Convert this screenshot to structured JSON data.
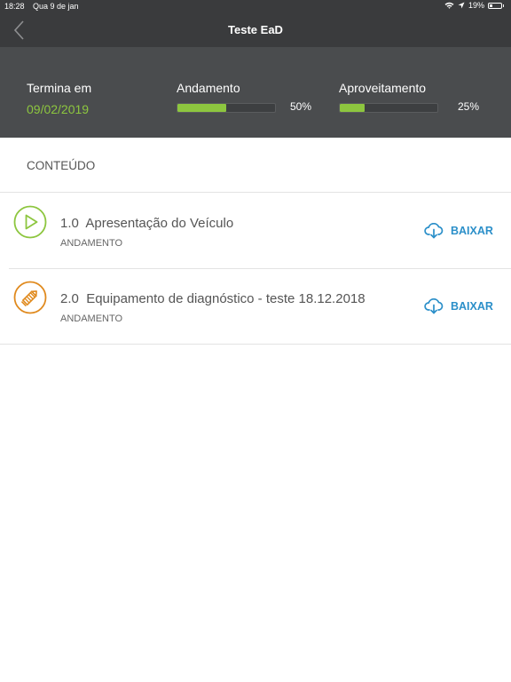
{
  "status_bar": {
    "time": "18:28",
    "date": "Qua 9 de jan",
    "battery": "19%"
  },
  "nav": {
    "title": "Teste EaD"
  },
  "summary": {
    "ends_label": "Termina em",
    "ends_date": "09/02/2019",
    "progress_label": "Andamento",
    "progress_value": "50%",
    "progress_fraction": 0.5,
    "score_label": "Aproveitamento",
    "score_value": "25%",
    "score_fraction": 0.25,
    "accent_color": "#8dc63f"
  },
  "content": {
    "section_title": "CONTEÚDO",
    "items": [
      {
        "number": "1.0",
        "title": "Apresentação do Veículo",
        "status": "ANDAMENTO",
        "icon": "play-icon",
        "icon_color": "#8dc63f",
        "action": "BAIXAR"
      },
      {
        "number": "2.0",
        "title": "Equipamento de diagnóstico - teste 18.12.2018",
        "status": "ANDAMENTO",
        "icon": "pencil-icon",
        "icon_color": "#e08a1e",
        "action": "BAIXAR"
      }
    ],
    "action_color": "#2b8fc9"
  }
}
